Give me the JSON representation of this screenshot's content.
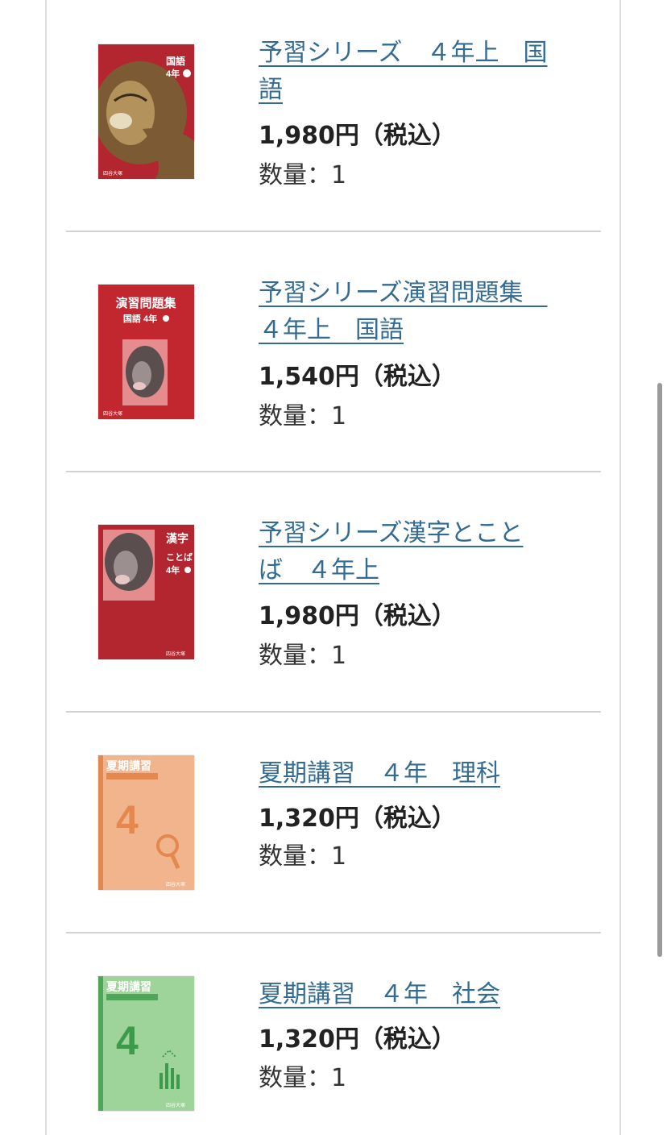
{
  "products": [
    {
      "title_line1": "予習シリーズ　４年上　国",
      "title_line2": "語",
      "price": "1,980円（税込）",
      "qty_label": "数量：1",
      "cover_icon": "lion-book-cover-icon",
      "cover_color": "#b3262f",
      "cover_text_main": "国語",
      "cover_text_sub": "4年"
    },
    {
      "title_line1": "予習シリーズ演習問題集　",
      "title_line2": "４年上　国語",
      "price": "1,540円（税込）",
      "qty_label": "数量：1",
      "cover_icon": "lion-workbook-cover-icon",
      "cover_color": "#c2262e",
      "cover_text_main": "演習問題集",
      "cover_text_sub": "国語 4年"
    },
    {
      "title_line1": "予習シリーズ漢字とこと",
      "title_line2": "ば　４年上",
      "price": "1,980円（税込）",
      "qty_label": "数量：1",
      "cover_icon": "lion-kanji-cover-icon",
      "cover_color": "#b3262f",
      "cover_text_main": "漢字",
      "cover_text_sub": "4年"
    },
    {
      "title_line1": "夏期講習　４年　理科",
      "title_line2": "",
      "price": "1,320円（税込）",
      "qty_label": "数量：1",
      "cover_icon": "science-book-cover-icon",
      "cover_color": "#f2b48d",
      "cover_text_main": "夏期講習",
      "cover_text_sub": "4"
    },
    {
      "title_line1": "夏期講習　４年　社会",
      "title_line2": "",
      "price": "1,320円（税込）",
      "qty_label": "数量：1",
      "cover_icon": "social-book-cover-icon",
      "cover_color": "#9ed39a",
      "cover_text_main": "夏期講習",
      "cover_text_sub": "4"
    }
  ]
}
